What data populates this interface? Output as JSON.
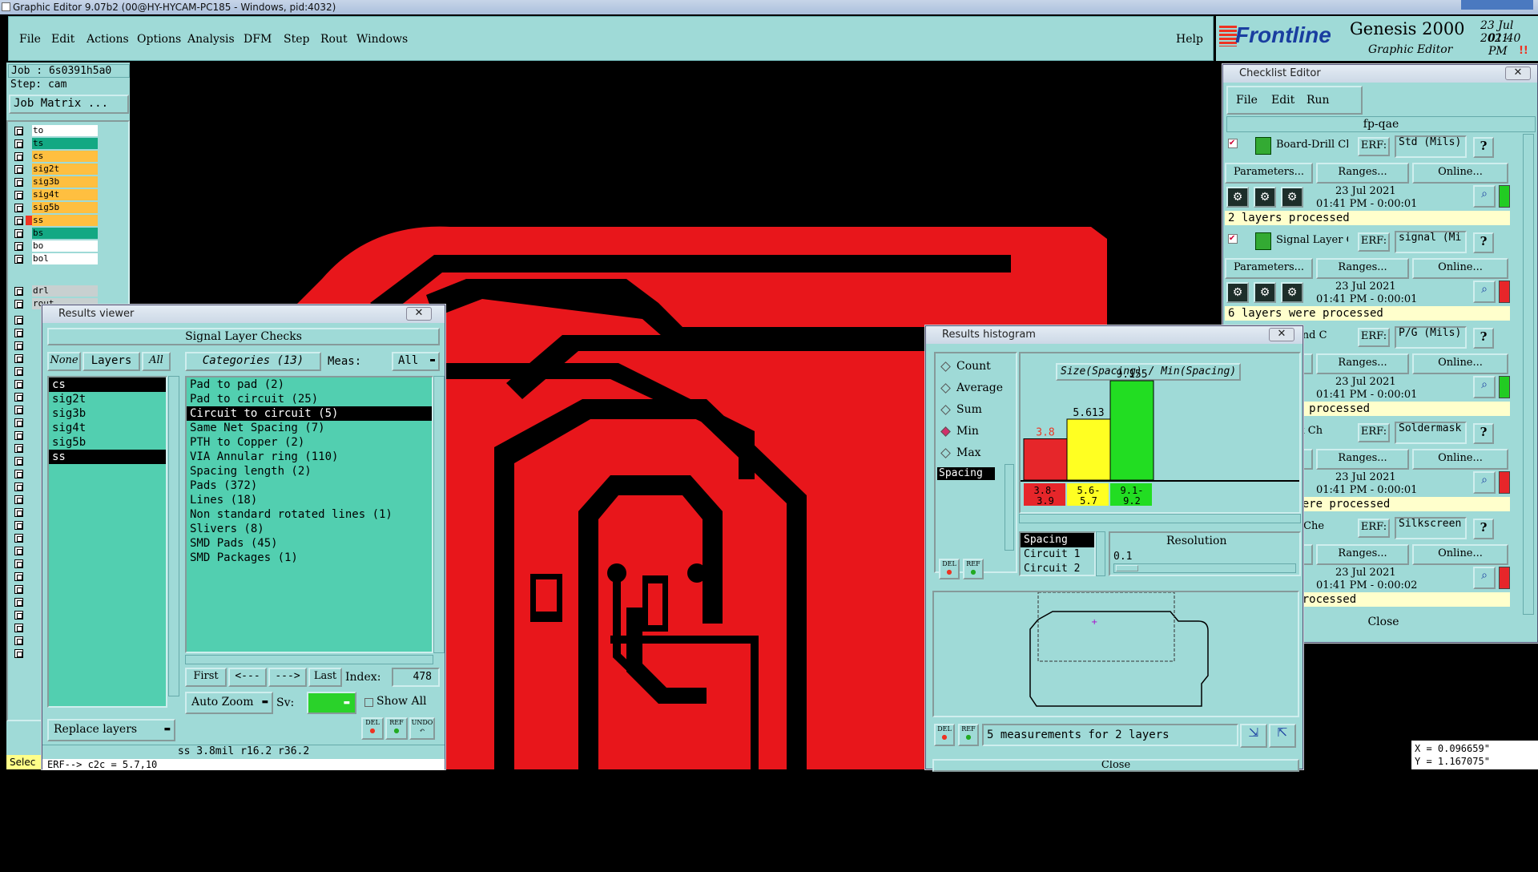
{
  "window_title": "Graphic Editor 9.07b2 (00@HY-HYCAM-PC185 - Windows, pid:4032)",
  "menu": [
    "File",
    "Edit",
    "Actions",
    "Options",
    "Analysis",
    "DFM",
    "Step",
    "Rout",
    "Windows"
  ],
  "help": "Help",
  "brand": {
    "logo": "Frontline",
    "product": "Genesis 2000",
    "subtitle": "Graphic Editor",
    "date": "23 Jul 2021",
    "time": "01:40 PM",
    "pause": "!!"
  },
  "job": {
    "job": "Job : 6s0391h5a0",
    "step": "Step: cam",
    "matrix_btn": "Job Matrix ..."
  },
  "layers": [
    {
      "name": "to",
      "color": "#ffffff"
    },
    {
      "name": "ts",
      "color": "#13a883"
    },
    {
      "name": "cs",
      "color": "#ffbf40"
    },
    {
      "name": "sig2t",
      "color": "#ffbf40"
    },
    {
      "name": "sig3b",
      "color": "#ffbf40"
    },
    {
      "name": "sig4t",
      "color": "#ffbf40"
    },
    {
      "name": "sig5b",
      "color": "#ffbf40"
    },
    {
      "name": "ss",
      "color": "#ffbf40"
    },
    {
      "name": "bs",
      "color": "#13a883"
    },
    {
      "name": "bo",
      "color": "#ffffff"
    },
    {
      "name": "bol",
      "color": "#ffffff"
    }
  ],
  "drill_layers": [
    "drl",
    "rout"
  ],
  "results_viewer": {
    "title": "Results viewer",
    "header": "Signal Layer Checks",
    "none": "None",
    "layers": "Layers",
    "all": "All",
    "categories": "Categories (13)",
    "meas_label": "Meas:",
    "meas_value": "All",
    "layer_list": [
      "cs",
      "sig2t",
      "sig3b",
      "sig4t",
      "sig5b",
      "ss"
    ],
    "category_list": [
      "Pad to pad (2)",
      "Pad to circuit (25)",
      "Circuit to circuit (5)",
      "Same Net Spacing (7)",
      "PTH to Copper (2)",
      "VIA Annular ring (110)",
      "Spacing length (2)",
      "Pads (372)",
      "Lines (18)",
      "Non standard rotated lines (1)",
      "Slivers (8)",
      "SMD Pads (45)",
      "SMD Packages (1)"
    ],
    "first": "First",
    "prev": "<---",
    "next": "--->",
    "last": "Last",
    "index_label": "Index:",
    "index_value": "478",
    "auto_zoom": "Auto Zoom",
    "sv": "Sv:",
    "show_all": "Show All",
    "replace_layers": "Replace layers",
    "del": "DEL",
    "ref": "REF",
    "undo": "UNDO",
    "status": "ss 3.8mil  r16.2  r36.2",
    "erf_line": "ERF--> c2c = 5.7,10"
  },
  "histogram": {
    "title": "Results histogram",
    "options": [
      "Count",
      "Average",
      "Sum",
      "Min",
      "Max"
    ],
    "selected_option": "Min",
    "chart_title": "Size(Spacing) / Min(Spacing)",
    "list": [
      "Spacing"
    ],
    "chart_data": {
      "type": "bar",
      "categories": [
        "3.8-3.9",
        "5.6-5.7",
        "9.1-9.2"
      ],
      "values": [
        3.8,
        5.613,
        9.155
      ],
      "value_labels": [
        "3.8",
        "5.613",
        "9.155"
      ],
      "colors": [
        "#e6262a",
        "#ffff22",
        "#22dd22"
      ],
      "title": "Size(Spacing) / Min(Spacing)"
    },
    "sub_list": [
      "Spacing",
      "Circuit 1",
      "Circuit 2"
    ],
    "resolution_label": "Resolution",
    "resolution_value": "0.1",
    "footer": "5 measurements for 2 layers",
    "close": "Close"
  },
  "checklist": {
    "title": "Checklist Editor",
    "menu": [
      "File",
      "Edit",
      "Run"
    ],
    "name": "fp-qae",
    "entries": [
      {
        "name": "Board-Drill Che",
        "erf": "Std (Mils)",
        "date": "23 Jul 2021",
        "time": "01:41 PM - 0:00:01",
        "status_text": "2 layers processed",
        "status_color": "#22cc22"
      },
      {
        "name": "Signal Layer Ch",
        "erf": "signal (Mi",
        "date": "23 Jul 2021",
        "time": "01:41 PM - 0:00:01",
        "status_text": "6 layers were processed",
        "status_color": "#e6262a"
      },
      {
        "name": "Ground C",
        "erf": "P/G (Mils)",
        "date": "23 Jul 2021",
        "time": "01:41 PM - 0:00:01",
        "status_text": "ound layers processed",
        "status_color": "#22cc22"
      },
      {
        "name": "Mask Ch",
        "erf": "Soldermask",
        "date": "23 Jul 2021",
        "time": "01:41 PM - 0:00:01",
        "status_text": "sk layers were processed",
        "status_color": "#e6262a"
      },
      {
        "name": "reen Che",
        "erf": "Silkscreen",
        "date": "23 Jul 2021",
        "time": "01:41 PM - 0:00:02",
        "status_text": "en layers processed",
        "status_color": "#e6262a"
      }
    ],
    "parameters": "Parameters...",
    "ranges": "Ranges...",
    "online": "Online...",
    "erf_label": "ERF:",
    "close": "Close"
  },
  "coords": {
    "x": "X = 0.096659\"",
    "y": "Y = 1.167075\""
  },
  "select_label": "Selec"
}
